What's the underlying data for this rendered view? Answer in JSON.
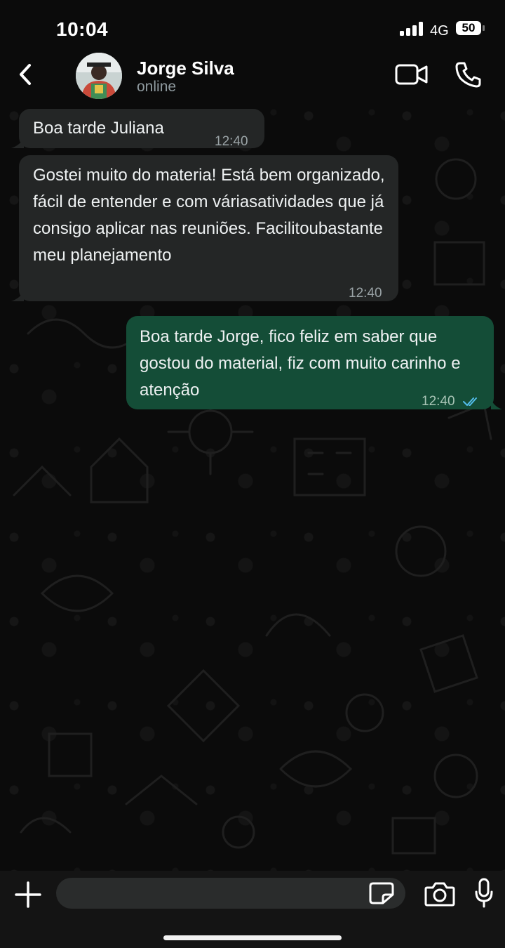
{
  "status_bar": {
    "time": "10:04",
    "network": "4G",
    "battery": "50"
  },
  "header": {
    "contact_name": "Jorge Silva",
    "contact_status": "online"
  },
  "messages": [
    {
      "direction": "incoming",
      "text": "Boa tarde Juliana",
      "time": "12:40"
    },
    {
      "direction": "incoming",
      "text": "Gostei muito do materia! Está bem organizado, fácil de entender e com váriasatividades que já consigo aplicar nas reuniões. Facilitoubastante meu planejamento",
      "time": "12:40"
    },
    {
      "direction": "outgoing",
      "text": "Boa tarde Jorge, fico feliz em saber que gostou do material, fiz com muito carinho e atenção",
      "time": "12:40",
      "read": true
    }
  ],
  "composer": {
    "input_value": "",
    "placeholder": ""
  },
  "icons": {
    "back": "chevron-left-icon",
    "video": "video-call-icon",
    "phone": "phone-icon",
    "plus": "plus-icon",
    "sticker": "sticker-icon",
    "camera": "camera-icon",
    "mic": "microphone-icon"
  },
  "colors": {
    "background": "#0b0b0b",
    "incoming_bubble": "#242626",
    "outgoing_bubble": "#144d37",
    "read_ticks": "#53bdeb"
  }
}
